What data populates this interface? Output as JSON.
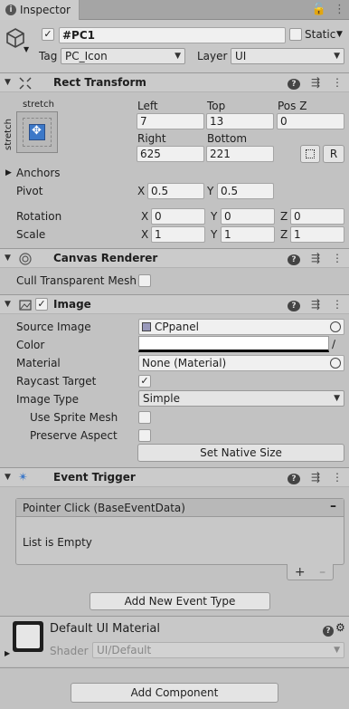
{
  "tab": {
    "title": "Inspector"
  },
  "object": {
    "name": "#PC1",
    "static_label": "Static",
    "tag_label": "Tag",
    "tag_value": "PC_Icon",
    "layer_label": "Layer",
    "layer_value": "UI"
  },
  "rect_transform": {
    "title": "Rect Transform",
    "anchor_top": "stretch",
    "anchor_side": "stretch",
    "left_label": "Left",
    "left_value": "7",
    "top_label": "Top",
    "top_value": "13",
    "posz_label": "Pos Z",
    "posz_value": "0",
    "right_label": "Right",
    "right_value": "625",
    "bottom_label": "Bottom",
    "bottom_value": "221",
    "r_label": "R",
    "anchors_label": "Anchors",
    "pivot_label": "Pivot",
    "pivot_x": "0.5",
    "pivot_y": "0.5",
    "rotation_label": "Rotation",
    "rot_x": "0",
    "rot_y": "0",
    "rot_z": "0",
    "scale_label": "Scale",
    "scale_x": "1",
    "scale_y": "1",
    "scale_z": "1",
    "x": "X",
    "y": "Y",
    "z": "Z"
  },
  "canvas_renderer": {
    "title": "Canvas Renderer",
    "cull_label": "Cull Transparent Mesh"
  },
  "image": {
    "title": "Image",
    "source_label": "Source Image",
    "source_value": "CPpanel",
    "color_label": "Color",
    "material_label": "Material",
    "material_value": "None (Material)",
    "raycast_label": "Raycast Target",
    "type_label": "Image Type",
    "type_value": "Simple",
    "sprite_mesh_label": "Use Sprite Mesh",
    "preserve_label": "Preserve Aspect",
    "native_size_label": "Set Native Size"
  },
  "event_trigger": {
    "title": "Event Trigger",
    "entry": "Pointer Click (BaseEventData)",
    "empty": "List is Empty",
    "add_label": "Add New Event Type"
  },
  "material": {
    "title": "Default UI Material",
    "shader_label": "Shader",
    "shader_value": "UI/Default"
  },
  "add_component_label": "Add Component"
}
